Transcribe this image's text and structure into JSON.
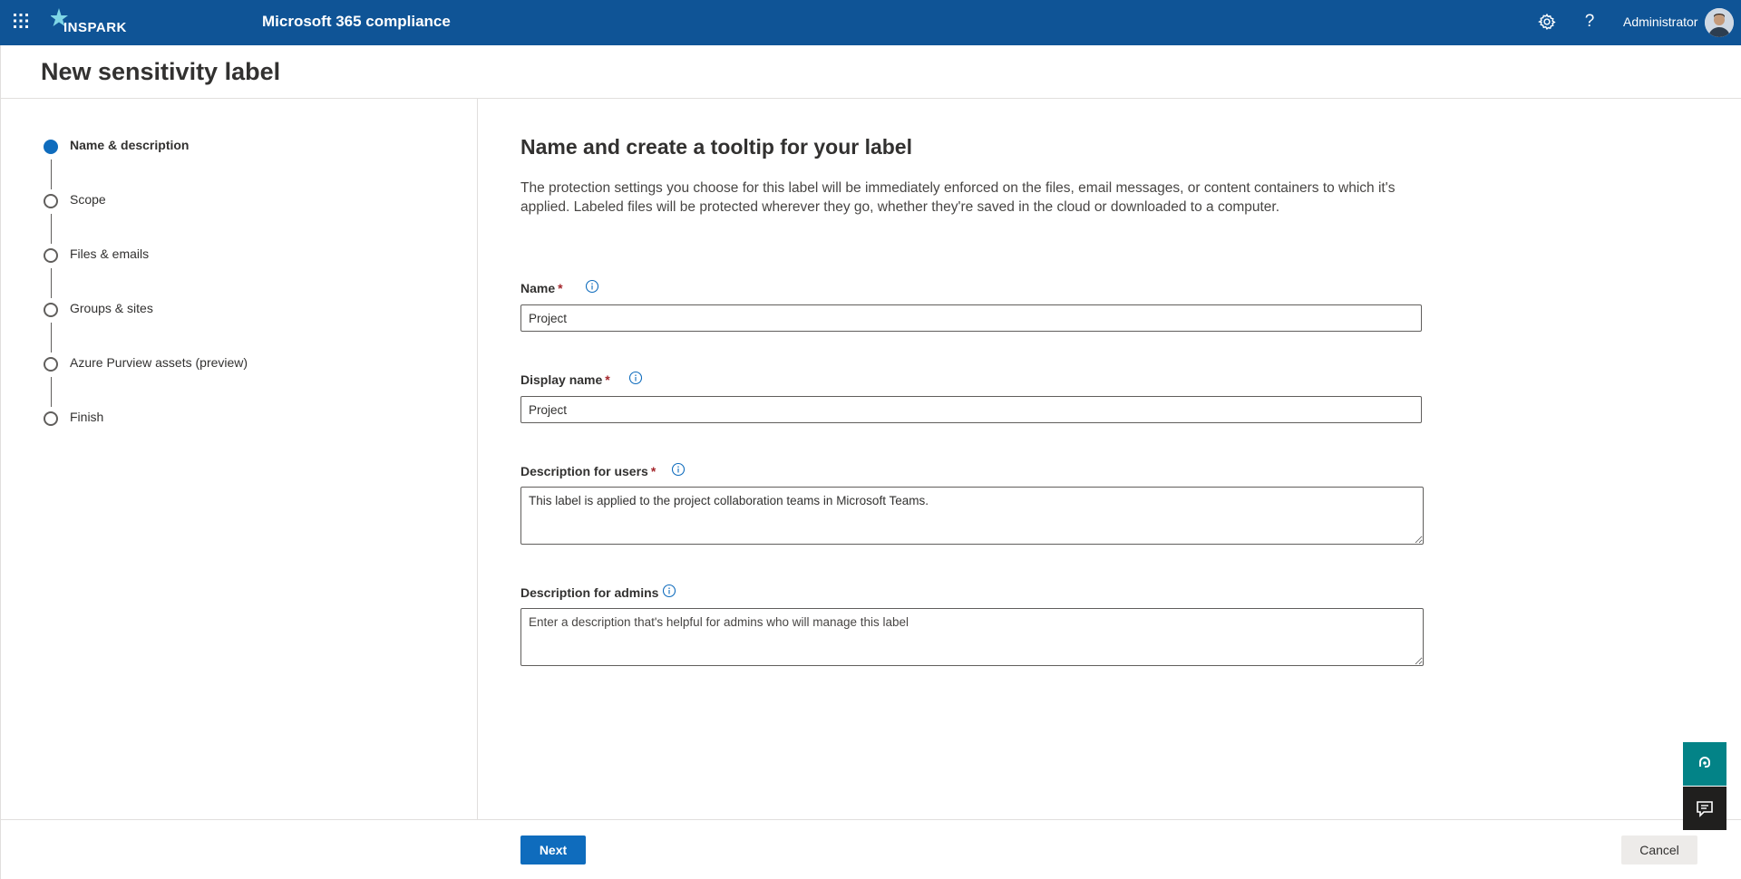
{
  "topbar": {
    "logo_text": "INSPARK",
    "app_title": "Microsoft 365 compliance",
    "help_glyph": "?",
    "user_name": "Administrator",
    "colors": {
      "bar": "#0f5496"
    }
  },
  "page": {
    "title": "New sensitivity label"
  },
  "steps": [
    {
      "label": "Name & description",
      "state": "current"
    },
    {
      "label": "Scope",
      "state": "pending"
    },
    {
      "label": "Files & emails",
      "state": "pending"
    },
    {
      "label": "Groups & sites",
      "state": "pending"
    },
    {
      "label": "Azure Purview assets (preview)",
      "state": "pending"
    },
    {
      "label": "Finish",
      "state": "pending"
    }
  ],
  "main": {
    "heading": "Name and create a tooltip for your label",
    "description": "The protection settings you choose for this label will be immediately enforced on the files, email messages, or content containers to which it's applied. Labeled files will be protected wherever they go, whether they're saved in the cloud or downloaded to a computer.",
    "fields": {
      "name": {
        "label": "Name",
        "required_mark": "*",
        "value": "Project"
      },
      "display_name": {
        "label": "Display name",
        "required_mark": "*",
        "value": "Project"
      },
      "desc_users": {
        "label": "Description for users",
        "required_mark": "*",
        "value": "This label is applied to the project collaboration teams in Microsoft Teams."
      },
      "desc_admins": {
        "label": "Description for admins",
        "value": "",
        "placeholder": "Enter a description that's helpful for admins who will manage this label"
      }
    }
  },
  "footer": {
    "next_label": "Next",
    "cancel_label": "Cancel"
  },
  "icons": {
    "waffle": "app-launcher-icon",
    "settings": "gear-icon",
    "help": "question-icon",
    "info": "info-icon",
    "help_float": "headset-help-icon",
    "feedback": "feedback-icon"
  },
  "colors": {
    "primary": "#0f6cbd",
    "required": "#a4262c",
    "help_float": "#038387",
    "feedback_float": "#201f1e"
  }
}
